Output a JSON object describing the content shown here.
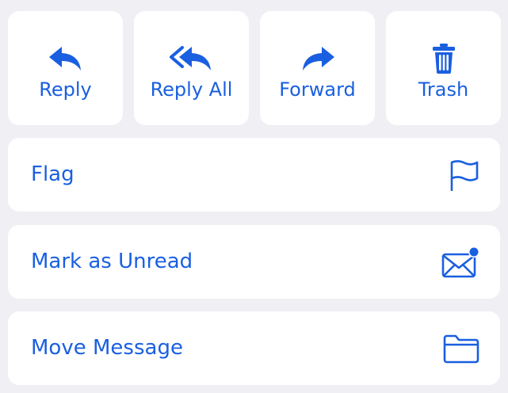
{
  "quick_actions": [
    {
      "label": "Reply",
      "icon": "reply-icon"
    },
    {
      "label": "Reply All",
      "icon": "reply-all-icon"
    },
    {
      "label": "Forward",
      "icon": "forward-icon"
    },
    {
      "label": "Trash",
      "icon": "trash-icon"
    }
  ],
  "menu_items": [
    {
      "label": "Flag",
      "icon": "flag-icon"
    },
    {
      "label": "Mark as Unread",
      "icon": "envelope-unread-icon"
    },
    {
      "label": "Move Message",
      "icon": "folder-icon"
    }
  ],
  "colors": {
    "accent": "#1a5fe0",
    "background": "#efeff4",
    "card": "#ffffff"
  }
}
